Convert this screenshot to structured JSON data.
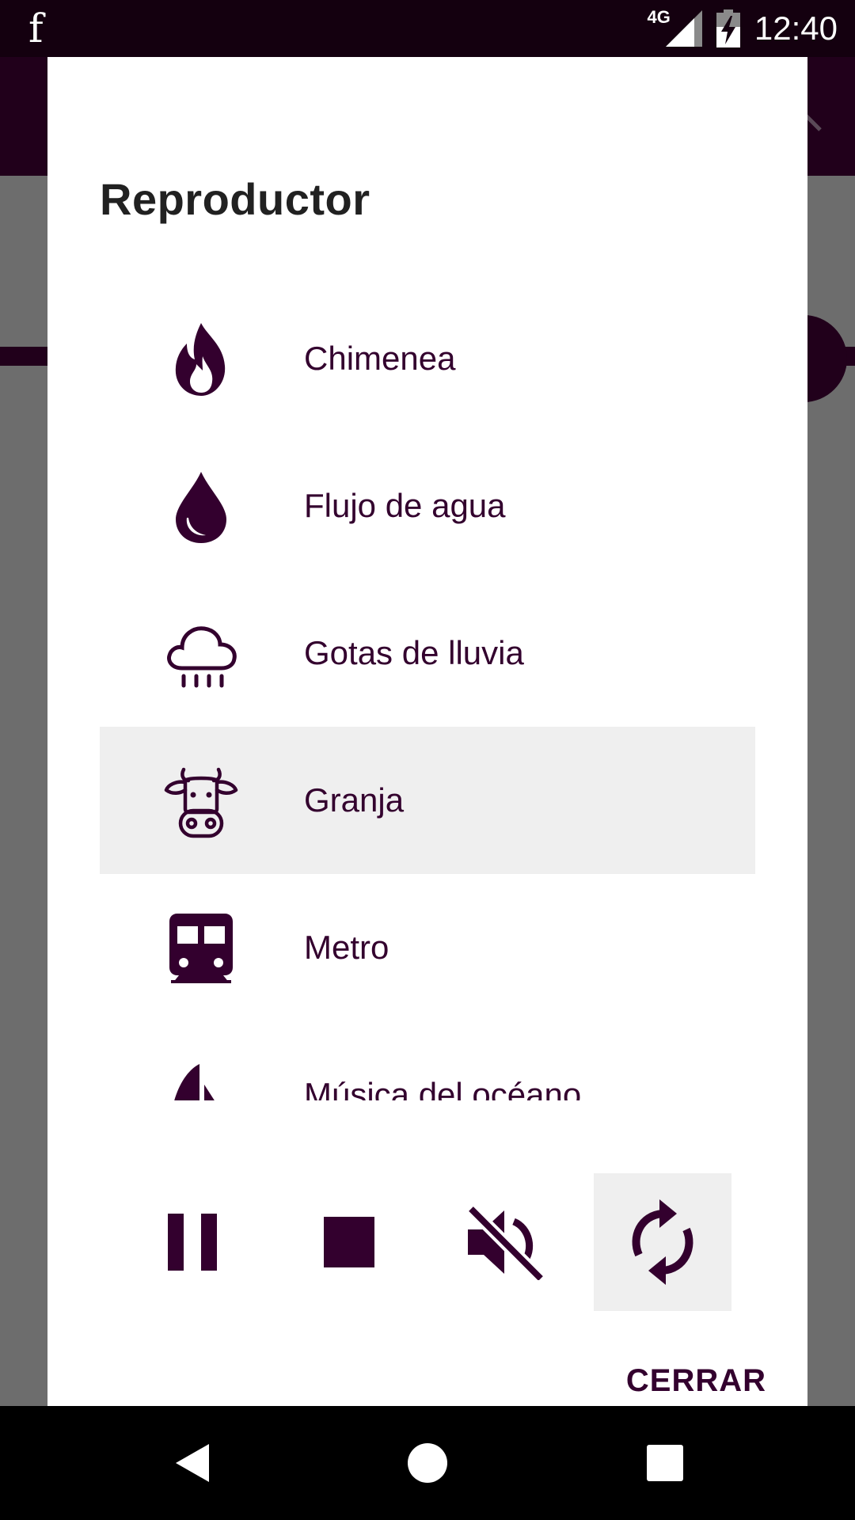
{
  "status_bar": {
    "app_icon": "f",
    "network": "4G",
    "clock": "12:40"
  },
  "dialog": {
    "title": "Reproductor",
    "items": [
      {
        "label": "Chimenea",
        "icon": "fire-icon",
        "selected": false
      },
      {
        "label": "Flujo de agua",
        "icon": "water-drop-icon",
        "selected": false
      },
      {
        "label": "Gotas de lluvia",
        "icon": "rain-cloud-icon",
        "selected": false
      },
      {
        "label": "Granja",
        "icon": "cow-icon",
        "selected": true
      },
      {
        "label": "Metro",
        "icon": "subway-icon",
        "selected": false
      },
      {
        "label": "Música del océano",
        "icon": "sailboat-icon",
        "selected": false
      }
    ],
    "controls": [
      {
        "icon": "pause-icon",
        "active": false
      },
      {
        "icon": "stop-icon",
        "active": false
      },
      {
        "icon": "volume-off-icon",
        "active": false
      },
      {
        "icon": "repeat-icon",
        "active": true
      }
    ],
    "close_label": "CERRAR"
  },
  "colors": {
    "accent": "#33002e",
    "status_bar": "#14000f",
    "toolbar": "#21001b",
    "selected_bg": "#efefef"
  }
}
